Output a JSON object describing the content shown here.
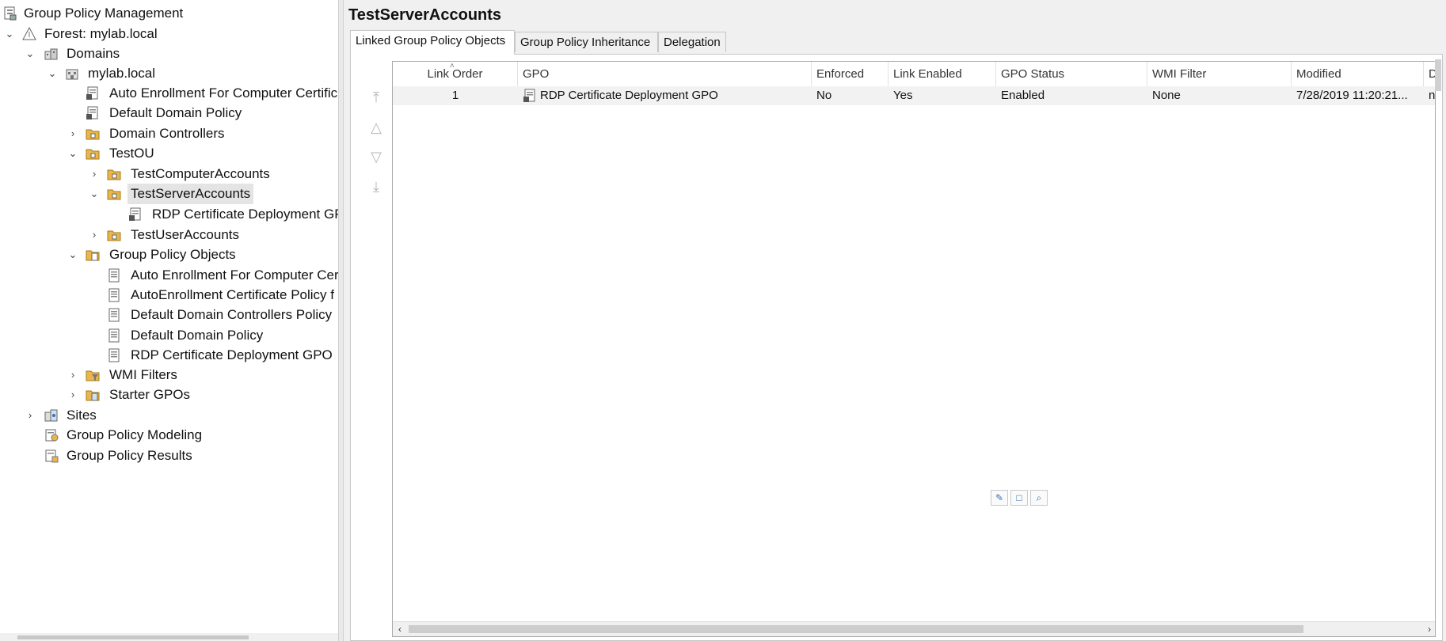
{
  "tree": {
    "root": "Group Policy Management",
    "forest": "Forest: mylab.local",
    "domains": "Domains",
    "domain": "mylab.local",
    "auto_enrollment_link": "Auto Enrollment For Computer Certific",
    "default_domain_policy_link": "Default Domain Policy",
    "domain_controllers": "Domain Controllers",
    "test_ou": "TestOU",
    "test_computer_accounts": "TestComputerAccounts",
    "test_server_accounts": "TestServerAccounts",
    "rdp_link": "RDP Certificate Deployment GP",
    "test_user_accounts": "TestUserAccounts",
    "gpo_container": "Group Policy Objects",
    "gpo_items": [
      "Auto Enrollment For Computer Cer",
      "AutoEnrollment Certificate Policy f",
      "Default Domain Controllers Policy",
      "Default Domain Policy",
      "RDP Certificate Deployment GPO"
    ],
    "wmi_filters": "WMI Filters",
    "starter_gpos": "Starter GPOs",
    "sites": "Sites",
    "modeling": "Group Policy Modeling",
    "results": "Group Policy Results"
  },
  "detail": {
    "title": "TestServerAccounts",
    "tabs": [
      "Linked Group Policy Objects",
      "Group Policy Inheritance",
      "Delegation"
    ],
    "active_tab": "Linked Group Policy Objects",
    "columns": [
      "Link Order",
      "GPO",
      "Enforced",
      "Link Enabled",
      "GPO Status",
      "WMI Filter",
      "Modified",
      "D"
    ],
    "rows": [
      {
        "link_order": "1",
        "gpo": "RDP Certificate Deployment GPO",
        "enforced": "No",
        "link_enabled": "Yes",
        "gpo_status": "Enabled",
        "wmi_filter": "None",
        "modified": "7/28/2019 11:20:21...",
        "extra": "n"
      }
    ]
  },
  "icons": {
    "root": "gpm-console-icon",
    "forest": "forest-icon",
    "domain": "domain-icon",
    "ou": "ou-folder-icon",
    "link": "gpo-link-icon",
    "gpo": "gpo-document-icon",
    "sites": "sites-icon",
    "modeling": "modeling-icon",
    "results": "results-icon"
  },
  "colors": {
    "folder": "#e8b64a",
    "selection": "#e4e4e4",
    "pane_bg": "#f0f0f0",
    "row_bg": "#f2f2f2"
  }
}
